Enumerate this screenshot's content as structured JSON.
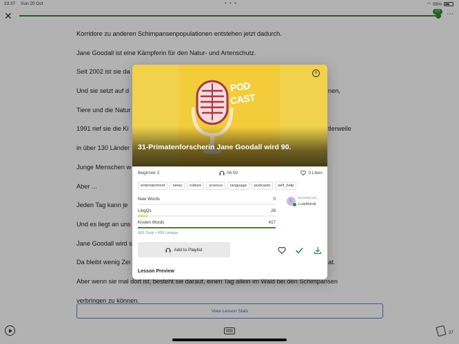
{
  "status": {
    "time": "23:37",
    "date": "Sun 20 Oct",
    "battery": "55%"
  },
  "progress": {
    "badge": "7/7",
    "fraction": 1.0
  },
  "reader": {
    "lines": [
      "Korridore zu anderen Schimpansenpopulationen entstehen jetzt dadurch.",
      "Jane Goodall ist eine Kämpferin für den Natur- und Artenschutz.",
      "Seit 2002 ist sie da",
      "Und sie setzt auf d",
      "nen,",
      "Tiere und die Natur",
      "1991 rief sie die Ki",
      "tlerweile",
      "in über 130 Länder",
      "Junge Menschen w",
      "Aber ...",
      "Jeden Tag kann je",
      "Und es liegt an uns",
      "Jane Goodall wird s",
      "Da bleibt wenig Zei",
      "at.",
      "Aber wenn sie mal dort ist, besteht sie darauf, einen Tag allein im Wald bei den Schimpansen",
      "verbringen zu können."
    ],
    "view_stats_label": "View Lesson Stats",
    "cards_count": "27"
  },
  "modal": {
    "cover_text_top": "POD",
    "cover_text_bottom": "CAST",
    "title": "31-Primatenforscherin Jane Goodall wird 90.",
    "level": "Beginner 2",
    "duration": "06:50",
    "likes": "0 Likes",
    "tags": [
      "entertainment",
      "news",
      "culture",
      "science",
      "language",
      "podcasts",
      "self_help"
    ],
    "stats": [
      {
        "label": "New Words",
        "value": "0",
        "fraction": 0.0,
        "color": "#cccccc"
      },
      {
        "label": "LingQs",
        "value": "28",
        "fraction": 0.07,
        "color": "#f2c94c"
      },
      {
        "label": "Known Words",
        "value": "417",
        "fraction": 1.0,
        "color": "#2f8a3a"
      }
    ],
    "totals": "965 Total  •  455 Unique",
    "shared_by_label": "SHARED BY",
    "shared_by_user": "LuisNorsk",
    "avatar_letter": "L",
    "playlist_label": "Add to Playlist",
    "lesson_preview": "Lesson Preview"
  }
}
